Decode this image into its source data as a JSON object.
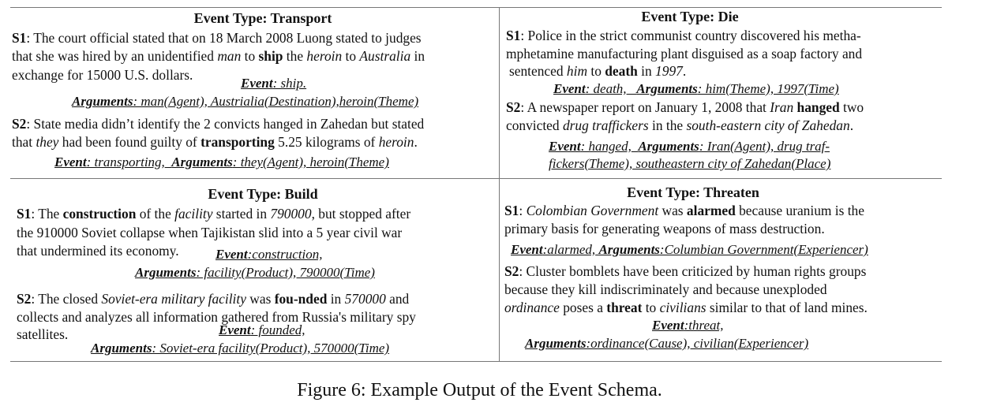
{
  "panels": {
    "transport": {
      "title": "Event Type: Transport",
      "s1": [
        [
          "S1",
          ": The court official stated that on 18 March 2008 Luong stated to judges"
        ],
        [
          "that she was hired by an unidentified ",
          "man",
          " to ",
          "ship",
          " the ",
          "heroin",
          " to ",
          "Australia",
          " in"
        ],
        [
          "exchange for 15000 U.S. dollars."
        ]
      ],
      "s1_event_label": "Event",
      "s1_event_value": ": ship.",
      "s1_args_label": "Arguments",
      "s1_args_value": ": man(Agent), Austrialia(Destination),heroin(Theme)",
      "s2": [
        [
          "S2",
          ": State media didn’t identify the 2 convicts hanged in Zahedan but stated"
        ],
        [
          "that ",
          "they",
          " had been found guilty of ",
          "transporting",
          " 5.25 kilograms of ",
          "heroin",
          "."
        ]
      ],
      "s2_ann_event_label": "Event",
      "s2_ann_event_value": ": transporting,",
      "s2_ann_args_label": "Arguments",
      "s2_ann_args_value": ": they(Agent), heroin(Theme)"
    },
    "die": {
      "title": "Event Type: Die",
      "s1_l1_a": "S1",
      "s1_l1_b": ": Police in the strict communist country discovered his metha-",
      "s1_l2": "mphetamine manufacturing plant disguised as a soap factory and",
      "s1_l3_a": "sentenced ",
      "s1_l3_b": "him",
      "s1_l3_c": " to ",
      "s1_l3_d": "death",
      "s1_l3_e": " in ",
      "s1_l3_f": "1997",
      "s1_l3_g": ".",
      "s1_ann_event_label": "Event",
      "s1_ann_event_value": ": death,",
      "s1_ann_args_label": "Arguments",
      "s1_ann_args_value": ": him(Theme), 1997(Time)",
      "s2_l1_a": "S2",
      "s2_l1_b": ": A newspaper report on January 1, 2008 that ",
      "s2_l1_c": "Iran",
      "s2_l1_d": " ",
      "s2_l1_e": "hanged",
      "s2_l1_f": " two",
      "s2_l2_a": "convicted ",
      "s2_l2_b": "drug traffickers",
      "s2_l2_c": " in the ",
      "s2_l2_d": "south-eastern city of Zahedan",
      "s2_l2_e": ".",
      "s2_ann_event_label": "Event",
      "s2_ann_event_value": ": hanged,",
      "s2_ann_args_label": "Arguments",
      "s2_ann_args_value": ": Iran(Agent), drug traf-",
      "s2_ann_args_value2": "fickers(Theme), southeastern city of Zahedan(Place)"
    },
    "build": {
      "title": "Event Type: Build",
      "s1_l1_a": "S1",
      "s1_l1_b": ": The ",
      "s1_l1_c": "construction",
      "s1_l1_d": " of the ",
      "s1_l1_e": "facility",
      "s1_l1_f": " started in ",
      "s1_l1_g": "790000",
      "s1_l1_h": ", but stopped after",
      "s1_l2": "the 910000 Soviet collapse when Tajikistan slid into a 5 year civil war",
      "s1_l3": "that undermined its economy.",
      "s1_ann_event_label": "Event",
      "s1_ann_event_value": ":construction,",
      "s1_ann_args_label": "Arguments",
      "s1_ann_args_value": ": facility(Product), 790000(Time)",
      "s2_l1_a": "S2",
      "s2_l1_b": ": The closed ",
      "s2_l1_c": "Soviet-era military facility",
      "s2_l1_d": " was ",
      "s2_l1_e": "fou-nded",
      "s2_l1_f": " in ",
      "s2_l1_g": "570000",
      "s2_l1_h": " and",
      "s2_l2": "collects and analyzes all information gathered from Russia's military spy",
      "s2_l3": "satellites.",
      "s2_ann_event_label": "Event",
      "s2_ann_event_value": ": founded,",
      "s2_ann_args_label": "Arguments",
      "s2_ann_args_value": ": Soviet-era facility(Product), 570000(Time)"
    },
    "threaten": {
      "title": "Event Type: Threaten",
      "s1_l1_a": "S1",
      "s1_l1_b": ": ",
      "s1_l1_c": "Colombian Government",
      "s1_l1_d": " was ",
      "s1_l1_e": "alarmed",
      "s1_l1_f": " because uranium is the",
      "s1_l2": "primary basis for generating weapons of mass destruction.",
      "s1_ann_event_label": "Event",
      "s1_ann_event_value": ":alarmed,",
      "s1_ann_args_label": "Arguments",
      "s1_ann_args_value": ":Columbian Government(Experiencer)",
      "s2_l1_a": "S2",
      "s2_l1_b": ": Cluster bomblets have been criticized by human rights groups",
      "s2_l2": "because they kill indiscriminately and because unexploded",
      "s2_l3_a": "ordinance",
      "s2_l3_b": " poses a ",
      "s2_l3_c": "threat",
      "s2_l3_d": " to ",
      "s2_l3_e": "civilians",
      "s2_l3_f": " similar to that of land mines.",
      "s2_ann_event_label": "Event",
      "s2_ann_event_value": ":threat,",
      "s2_ann_args_label": "Arguments",
      "s2_ann_args_value": ":ordinance(Cause), civilian(Experiencer)"
    }
  },
  "caption": "Figure 6: Example Output of the Event Schema."
}
